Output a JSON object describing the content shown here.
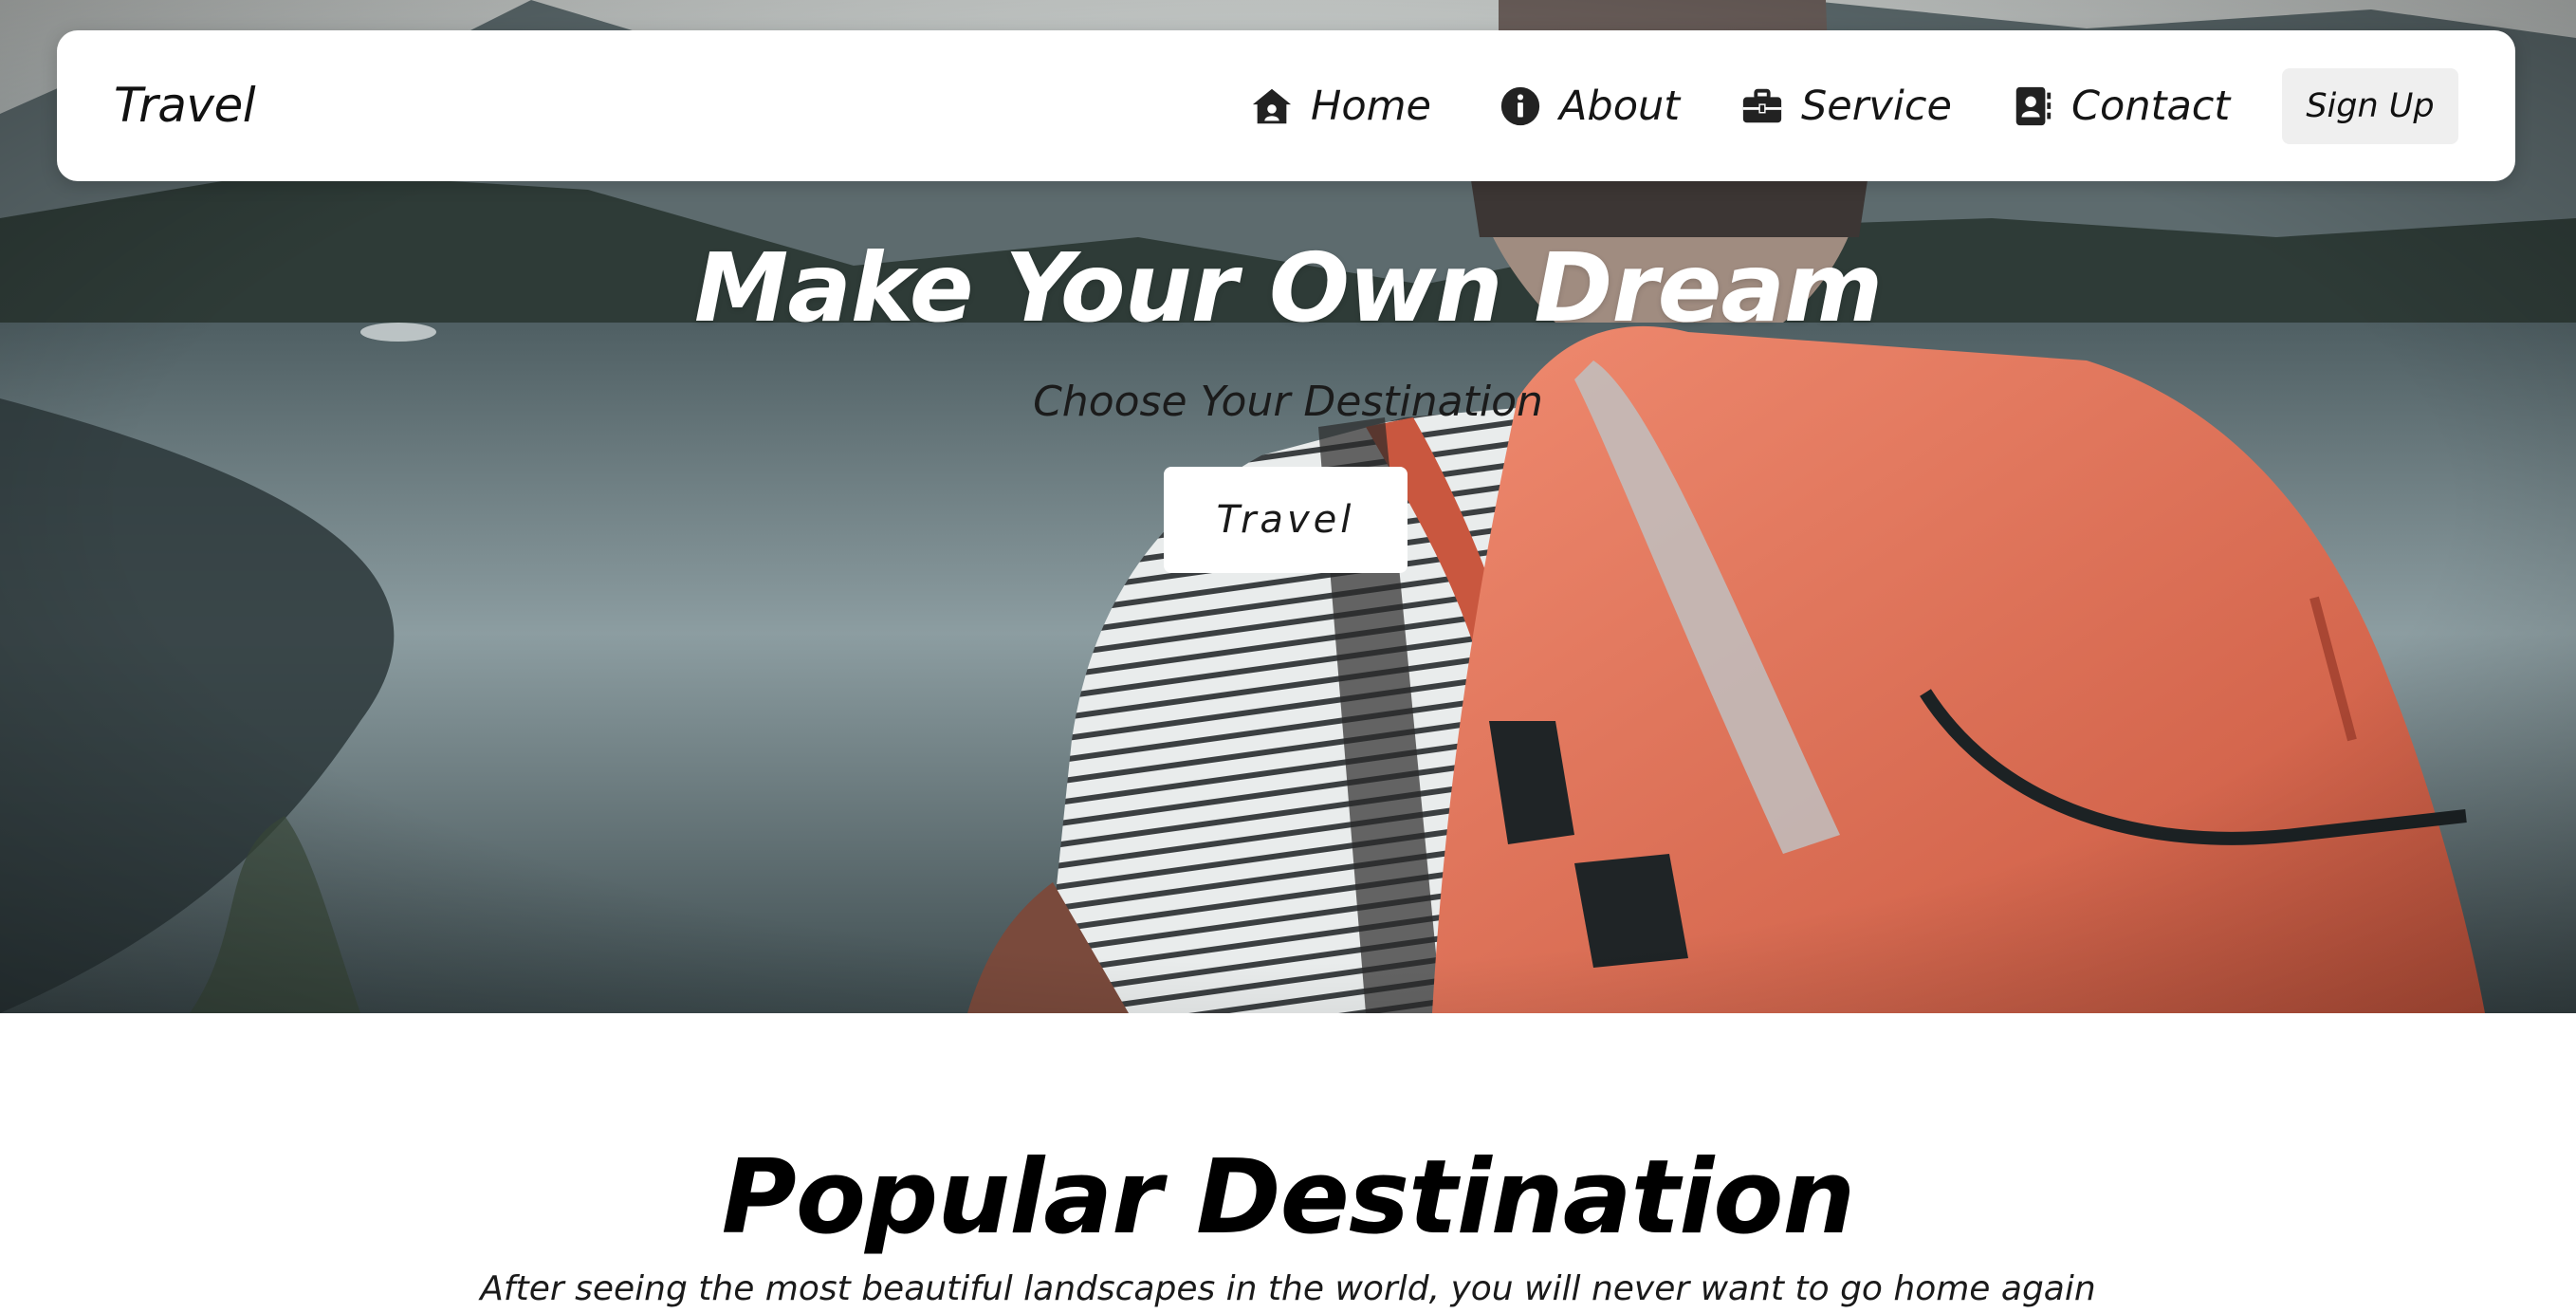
{
  "navbar": {
    "brand": "Travel",
    "items": [
      {
        "label": "Home",
        "icon": "house-icon"
      },
      {
        "label": "About",
        "icon": "info-circle-icon"
      },
      {
        "label": "Service",
        "icon": "briefcase-icon"
      },
      {
        "label": "Contact",
        "icon": "contact-card-icon"
      }
    ],
    "signup_label": "Sign Up"
  },
  "hero": {
    "title": "Make Your Own Dream",
    "subtitle": "Choose Your Destination",
    "cta_label": "Travel"
  },
  "popular": {
    "title": "Popular Destination",
    "subtitle": "After seeing the most beautiful landscapes in the world, you will never want to go home again"
  },
  "colors": {
    "navbar_bg": "#ffffff",
    "signup_bg": "#efefef",
    "backpack": "#e07a5f",
    "lake": "#7f9196"
  }
}
